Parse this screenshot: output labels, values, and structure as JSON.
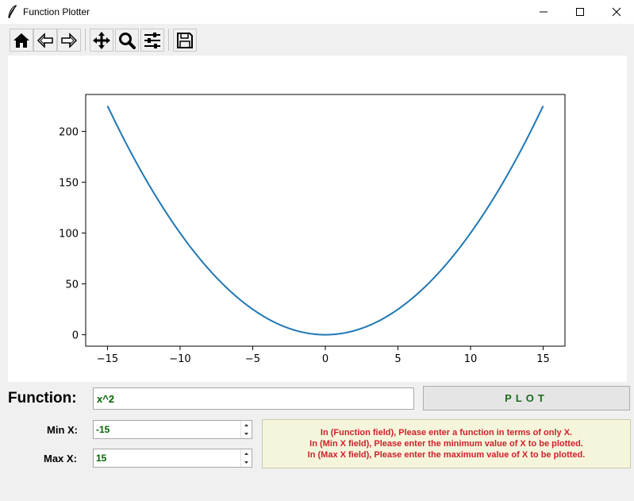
{
  "window": {
    "title": "Function Plotter",
    "minimize_icon": "minimize-icon",
    "maximize_icon": "maximize-icon",
    "close_icon": "close-icon"
  },
  "toolbar": {
    "buttons": [
      {
        "name": "home",
        "icon": "home-icon"
      },
      {
        "name": "back",
        "icon": "back-arrow-icon"
      },
      {
        "name": "forward",
        "icon": "forward-arrow-icon"
      },
      {
        "name": "pan",
        "icon": "move-icon"
      },
      {
        "name": "zoom",
        "icon": "zoom-icon"
      },
      {
        "name": "configure",
        "icon": "sliders-icon"
      },
      {
        "name": "save",
        "icon": "save-icon"
      }
    ]
  },
  "chart_data": {
    "type": "line",
    "function": "x^2",
    "x": [
      -15,
      -14,
      -13,
      -12,
      -11,
      -10,
      -9,
      -8,
      -7,
      -6,
      -5,
      -4,
      -3,
      -2,
      -1,
      0,
      1,
      2,
      3,
      4,
      5,
      6,
      7,
      8,
      9,
      10,
      11,
      12,
      13,
      14,
      15
    ],
    "series": [
      {
        "values": [
          225,
          196,
          169,
          144,
          121,
          100,
          81,
          64,
          49,
          36,
          25,
          16,
          9,
          4,
          1,
          0,
          1,
          4,
          9,
          16,
          25,
          36,
          49,
          64,
          81,
          100,
          121,
          144,
          169,
          196,
          225
        ],
        "color": "#1f77b4"
      }
    ],
    "xlim": [
      -16.5,
      16.5
    ],
    "ylim": [
      -11.25,
      236.25
    ],
    "xticks": [
      "−15",
      "−10",
      "−5",
      "0",
      "5",
      "10",
      "15"
    ],
    "yticks": [
      "0",
      "50",
      "100",
      "150",
      "200"
    ],
    "title": "",
    "xlabel": "",
    "ylabel": "",
    "grid": false
  },
  "controls": {
    "function_label": "Function:",
    "function_value": "x^2",
    "plot_button": "PLOT",
    "min_label": "Min X:",
    "min_value": "-15",
    "max_label": "Max X:",
    "max_value": "15"
  },
  "info": {
    "lines": [
      "In (Function field), Please enter a function in terms of only X.",
      "In (Min X field), Please enter the minimum value of X to be plotted.",
      "In (Max X field), Please enter the maximum value of X to be plotted."
    ]
  },
  "colors": {
    "line": "#1f77b4",
    "input_text": "#006400",
    "info_text": "#d0202a",
    "info_bg": "#f5f5dc"
  }
}
